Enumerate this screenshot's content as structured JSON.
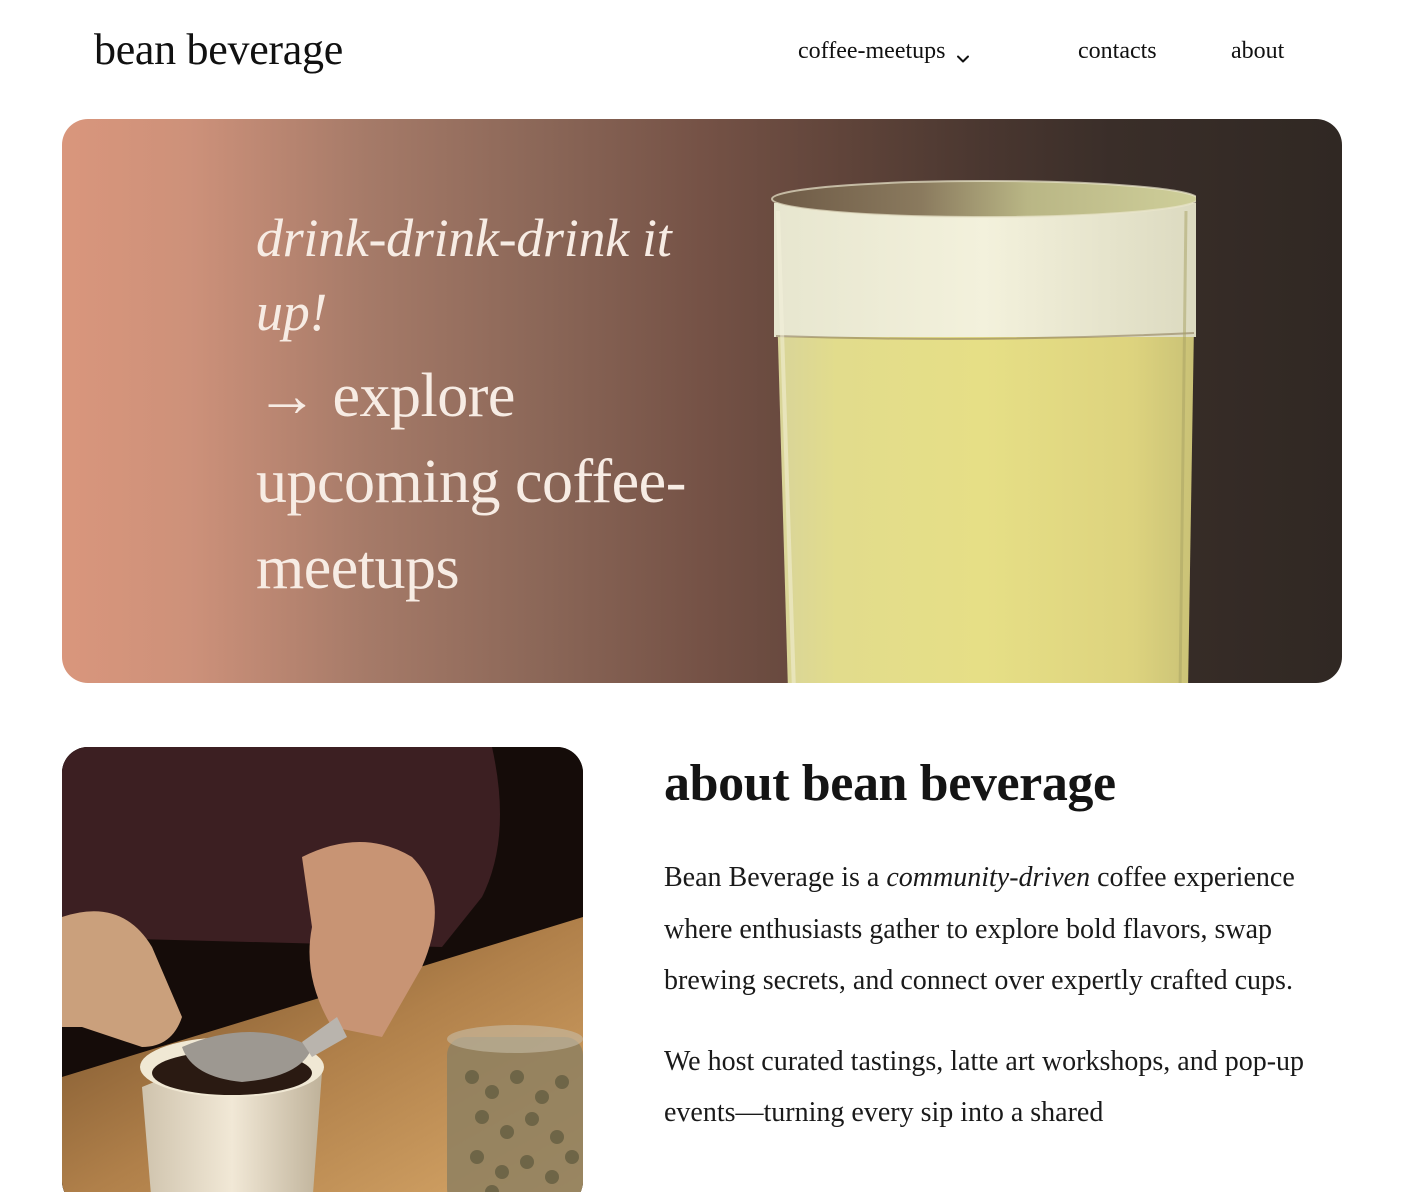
{
  "header": {
    "brand": "bean beverage",
    "nav": {
      "meetups_label": "coffee-meetups",
      "contacts_label": "contacts",
      "about_label": "about"
    }
  },
  "hero": {
    "tagline": "drink-drink-drink it up!",
    "cta_label": "→ explore upcoming coffee-meetups"
  },
  "about": {
    "title": "about bean beverage",
    "paragraph1": {
      "before": "Bean Beverage is a ",
      "emphasis": "community-driven",
      "after": " coffee experience where enthusiasts gather to explore bold flavors, swap brewing secrets, and connect over expertly crafted cups."
    },
    "paragraph2": "We host curated tastings, latte art workshops, and pop-up events—turning every sip into a shared"
  },
  "icons": {
    "nav_dropdown": "chevron-down-icon"
  },
  "colors": {
    "hero_gradient_start": "#d9967c",
    "hero_gradient_end": "#302823",
    "hero_text": "#f7ece4"
  }
}
